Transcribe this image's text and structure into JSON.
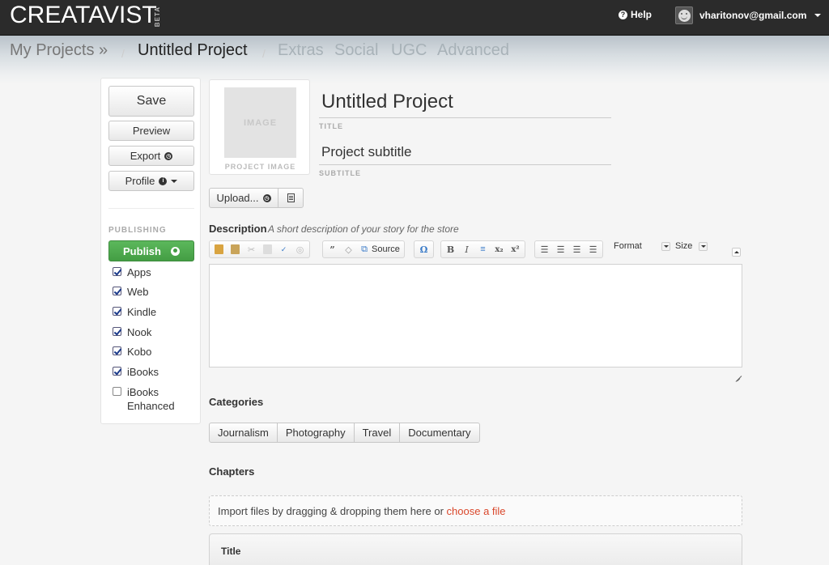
{
  "app": {
    "logo": "CREATAVIST",
    "logo_badge": "BETA",
    "help_label": "Help",
    "user_email": "vharitonov@gmail.com"
  },
  "breadcrumb": {
    "my_projects": "My Projects »",
    "separator": "/",
    "project_name": "Untitled Project",
    "tabs": [
      "Extras",
      "Social",
      "UGC",
      "Advanced"
    ]
  },
  "sidebar": {
    "save_label": "Save",
    "preview_label": "Preview",
    "export_label": "Export",
    "profile_label": "Profile",
    "publishing_label": "PUBLISHING",
    "publish_label": "Publish",
    "platforms": [
      {
        "label": "Apps",
        "checked": true
      },
      {
        "label": "Web",
        "checked": true
      },
      {
        "label": "Kindle",
        "checked": true
      },
      {
        "label": "Nook",
        "checked": true
      },
      {
        "label": "Kobo",
        "checked": true
      },
      {
        "label": "iBooks",
        "checked": true
      },
      {
        "label": "iBooks Enhanced",
        "checked": false
      }
    ]
  },
  "project": {
    "image_placeholder": "IMAGE",
    "image_label": "PROJECT IMAGE",
    "title_value": "Untitled Project",
    "title_label": "TITLE",
    "subtitle_value": "Project subtitle",
    "subtitle_label": "SUBTITLE",
    "upload_label": "Upload..."
  },
  "description": {
    "label": "Description",
    "hint": "A short description of your story for the store",
    "toolbar": {
      "source_label": "Source",
      "format_label": "Format",
      "size_label": "Size"
    }
  },
  "categories": {
    "label": "Categories",
    "items": [
      "Journalism",
      "Photography",
      "Travel",
      "Documentary"
    ]
  },
  "chapters": {
    "label": "Chapters",
    "dropzone_text": "Import files by dragging & dropping them here or ",
    "dropzone_link": "choose a file",
    "table_header_title": "Title"
  },
  "colors": {
    "topbar": "#2b2b2b",
    "publish_green": "#5cb85c",
    "link_red": "#d9472b"
  }
}
